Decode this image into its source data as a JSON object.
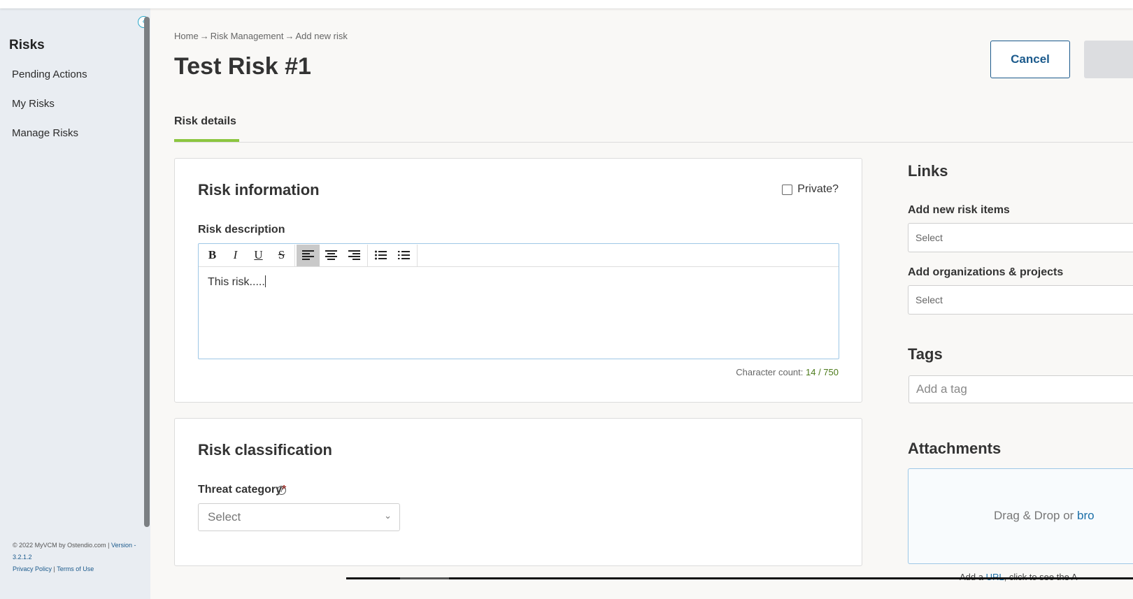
{
  "sidebar": {
    "title": "Risks",
    "items": [
      {
        "label": "Pending Actions"
      },
      {
        "label": "My Risks"
      },
      {
        "label": "Manage Risks"
      }
    ],
    "footer": {
      "copyright": "© 2022 MyVCM by Ostendio.com | ",
      "version_label": "Version - 3.2.1.2",
      "privacy": "Privacy Policy",
      "separator": " | ",
      "terms": "Terms of Use"
    }
  },
  "header": {
    "breadcrumb": [
      "Home",
      "→",
      "Risk Management",
      "→",
      "Add new risk"
    ],
    "title": "Test Risk #1",
    "cancel_label": "Cancel"
  },
  "tabs": [
    {
      "label": "Risk details",
      "active": true
    }
  ],
  "risk_information": {
    "title": "Risk information",
    "private_label": "Private?",
    "private_checked": false,
    "description_label": "Risk description",
    "toolbar": {
      "bold": "B",
      "italic": "I",
      "underline": "U",
      "strike": "S"
    },
    "description_value": "This risk.....",
    "char_count_label": "Character count: ",
    "char_count_value": "14 / 750"
  },
  "risk_classification": {
    "title": "Risk classification",
    "threat_label": "Threat category",
    "required_marker": "*",
    "threat_placeholder": "Select"
  },
  "links": {
    "title": "Links",
    "risk_items_label": "Add new risk items",
    "risk_items_placeholder": "Select",
    "orgs_label": "Add organizations & projects",
    "orgs_placeholder": "Select"
  },
  "tags": {
    "title": "Tags",
    "placeholder": "Add a tag"
  },
  "attachments": {
    "title": "Attachments",
    "drop_text": "Drag & Drop or ",
    "browse_text": "bro",
    "below_prefix": "Add a ",
    "below_link": "URL",
    "below_suffix": ", click to see the A"
  },
  "colors": {
    "accent_green": "#8cc63f",
    "brand_blue": "#1b5a8c",
    "sidebar_bg": "#e9edf2"
  }
}
